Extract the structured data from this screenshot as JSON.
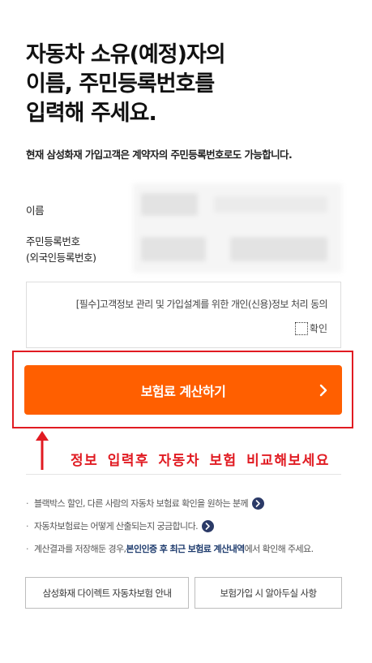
{
  "heading": {
    "line1": "자동차 소유(예정)자의",
    "line2": "이름, 주민등록번호를",
    "line3": "입력해 주세요."
  },
  "subtitle": "현재 삼성화재 가입고객은 계약자의 주민등록번호로도 가능합니다.",
  "form": {
    "name_label": "이름",
    "rrn_label_line1": "주민등록번호",
    "rrn_label_line2": "(외국인등록번호)"
  },
  "consent": {
    "text": "[필수]고객정보 관리 및 가입설계를 위한 개인(신용)정보 처리 동의",
    "confirm_label": "확인"
  },
  "cta": {
    "label": "보험료 계산하기"
  },
  "annotation": "정보 입력후 자동차 보험 비교해보세요",
  "info": {
    "item1": "블랙박스 할인, 다른 사람의 자동차 보험료 확인을 원하는 분께",
    "item2": "자동차보험료는 어떻게 산출되는지 궁금합니다.",
    "item3_pre": "계산결과를 저장해둔 경우, ",
    "item3_link": "본인인증 후 최근 보험료 계산내역",
    "item3_post": "에서 확인해 주세요."
  },
  "bottom_buttons": {
    "left": "삼성화재 다이렉트 자동차보험 안내",
    "right": "보험가입 시 알아두실 사항"
  },
  "colors": {
    "accent": "#ff5f00",
    "annotation_red": "#e11b22",
    "link_navy": "#1f3c6e"
  }
}
